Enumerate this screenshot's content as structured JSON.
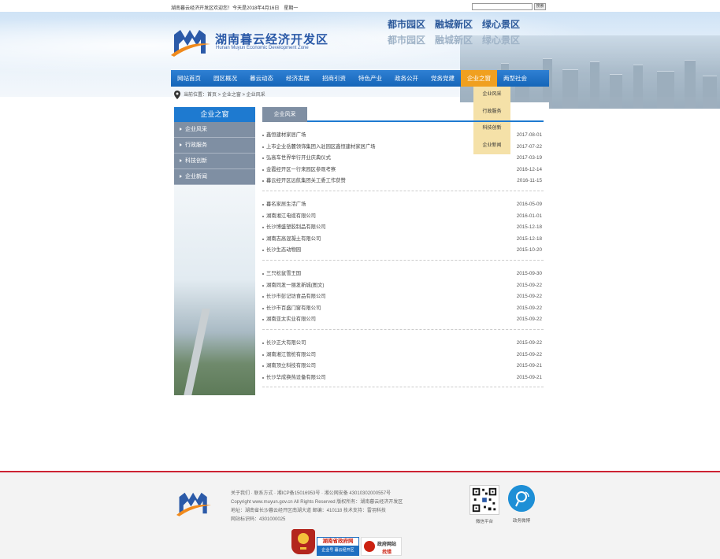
{
  "topbar": {
    "welcome": "湖南暮云经济开发区欢迎您！今天是2018年4月16日　星期一",
    "search_button": "搜索",
    "search_placeholder": ""
  },
  "header": {
    "title_cn": "湖南暮云经济开发区",
    "title_en": "Hunan Muyun Economic Development Zone",
    "slogan": "都市园区　融城新区　绿心景区"
  },
  "nav": {
    "items": [
      "网站首页",
      "园区概况",
      "暮云动态",
      "经济发展",
      "招商引资",
      "特色产业",
      "政务公开",
      "党务党建",
      "企业之窗",
      "两型社会"
    ],
    "dropdown": [
      "企业风采",
      "行政服务",
      "科技创新",
      "企业新闻"
    ]
  },
  "breadcrumb": "当前位置：首页 > 企业之窗 > 企业风采",
  "sidebar": {
    "heading": "企业之窗",
    "items": [
      "企业风采",
      "行政服务",
      "科技创新",
      "企业新闻"
    ]
  },
  "content": {
    "tab": "企业风采",
    "groups": [
      [
        {
          "title": "鑫恒建材家居广场",
          "date": "2017-08-01"
        },
        {
          "title": "上市企业岳麓领饰集团入驻园区鑫恒建材家居广场",
          "date": "2017-07-22"
        },
        {
          "title": "弘高车世界举行开业庆典仪式",
          "date": "2017-03-19"
        },
        {
          "title": "金霞经开区一行来园区参观考察",
          "date": "2016-12-14"
        },
        {
          "title": "暮云经开区远航集团关工委工作获赞",
          "date": "2016-11-15"
        }
      ],
      [
        {
          "title": "暮名家居生活广场",
          "date": "2016-05-09"
        },
        {
          "title": "湖南湘江电缆有限公司",
          "date": "2016-01-01"
        },
        {
          "title": "长沙博盛塑胶制品有限公司",
          "date": "2015-12-18"
        },
        {
          "title": "湖南志高混凝土有限公司",
          "date": "2015-12-18"
        },
        {
          "title": "长沙生态动物园",
          "date": "2015-10-20"
        }
      ],
      [
        {
          "title": "三只松鼠雪王国",
          "date": "2015-09-30"
        },
        {
          "title": "湖南同发一丽发新城(图文)",
          "date": "2015-09-22"
        },
        {
          "title": "长沙市彭记坊食品有限公司",
          "date": "2015-09-22"
        },
        {
          "title": "长沙市百盛门窗有限公司",
          "date": "2015-09-22"
        },
        {
          "title": "湖南亚太实业有限公司",
          "date": "2015-09-22"
        }
      ],
      [
        {
          "title": "长沙正大有限公司",
          "date": "2015-09-22"
        },
        {
          "title": "湖南湘江管桩有限公司",
          "date": "2015-09-22"
        },
        {
          "title": "湖南顶立科技有限公司",
          "date": "2015-09-21"
        },
        {
          "title": "长沙华成换热设备有限公司",
          "date": "2015-09-21"
        }
      ]
    ]
  },
  "footer": {
    "line1": "关于我们 · 联系方式 · 湘ICP备15016953号 · 湘公网安备 43010302000557号",
    "line2": "Copyright www.muyun.gov.cn All Rights Reserved  版权所有：湖南暮云经济开发区",
    "line3": "地址：湖南省长沙暮云经开区南湖大道  邮编：410118  技术支持：雷羽科技",
    "line4": "网站标识码：4301000025",
    "qr_label": "微信平台",
    "weibo_label": "政务微博",
    "badge_gov": "湖南省政府网",
    "badge_gov_sub": "企业号 暮云经开区",
    "badge_site": "政府网站",
    "badge_site_sub": "找错"
  },
  "colors": {
    "nav_blue": "#1e7ad0",
    "nav_active": "#f0a020",
    "sidebar_gray": "#7f8fa3",
    "footer_rule": "#cc2233"
  }
}
